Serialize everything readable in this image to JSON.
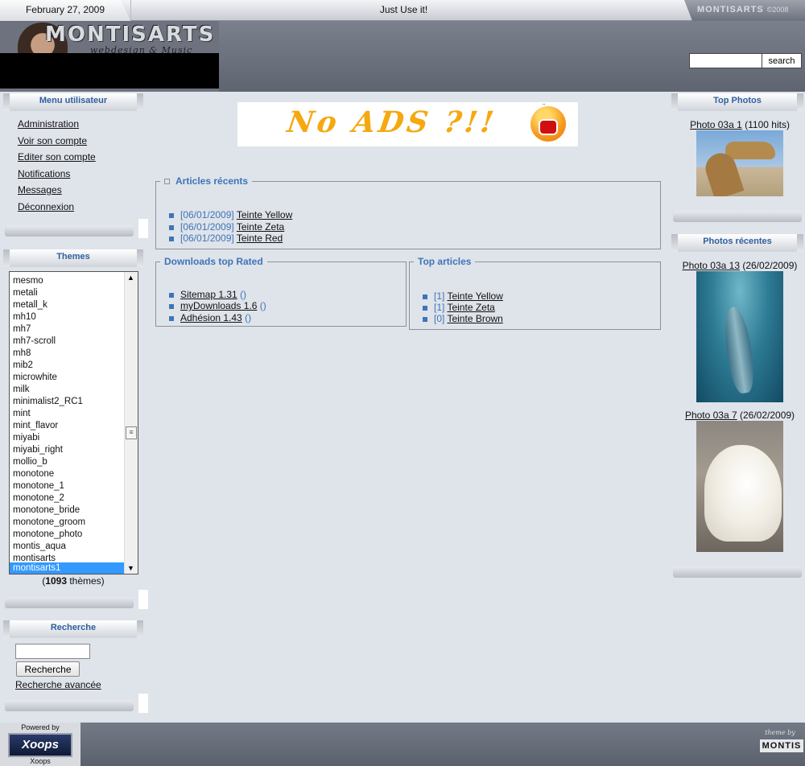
{
  "topbar": {
    "date": "February 27, 2009",
    "slogan": "Just Use it!",
    "brand": "MONTISARTS",
    "brand_year": "©2008"
  },
  "header": {
    "logo_text": "MONTISARTS",
    "logo_sub": "webdesign & Music",
    "search_button": "search",
    "search_value": ""
  },
  "left": {
    "user_menu_title": "Menu utilisateur",
    "user_menu": [
      "Administration",
      "Voir son compte",
      "Editer son compte",
      "Notifications",
      "Messages",
      "Déconnexion"
    ],
    "themes_title": "Themes",
    "themes": [
      "mesmo",
      "metali",
      "metall_k",
      "mh10",
      "mh7",
      "mh7-scroll",
      "mh8",
      "mib2",
      "microwhite",
      "milk",
      "minimalist2_RC1",
      "mint",
      "mint_flavor",
      "miyabi",
      "miyabi_right",
      "mollio_b",
      "monotone",
      "monotone_1",
      "monotone_2",
      "monotone_bride",
      "monotone_groom",
      "monotone_photo",
      "montis_aqua",
      "montisarts",
      "montisarts1"
    ],
    "themes_selected": "montisarts1",
    "themes_count_open": "(",
    "themes_count_num": "1093",
    "themes_count_label": " thèmes)",
    "search_title": "Recherche",
    "search_button": "Recherche",
    "advanced_search": "Recherche avancée"
  },
  "center": {
    "ad_text": "No ADS ?!!",
    "recent_articles": {
      "legend": "Articles récents",
      "items": [
        {
          "date": "[06/01/2009]",
          "title": "Teinte Yellow"
        },
        {
          "date": "[06/01/2009]",
          "title": "Teinte Zeta"
        },
        {
          "date": "[06/01/2009]",
          "title": "Teinte Red"
        }
      ]
    },
    "downloads": {
      "legend": "Downloads top Rated",
      "items": [
        {
          "title": "Sitemap 1.31",
          "paren": "()"
        },
        {
          "title": "myDownloads 1.6",
          "paren": "()"
        },
        {
          "title": "Adhésion 1.43",
          "paren": "()"
        }
      ]
    },
    "top_articles": {
      "legend": "Top articles",
      "items": [
        {
          "count": "[1]",
          "title": "Teinte Yellow"
        },
        {
          "count": "[1]",
          "title": "Teinte Zeta"
        },
        {
          "count": "[0]",
          "title": "Teinte Brown"
        }
      ]
    }
  },
  "right": {
    "top_photos_title": "Top Photos",
    "top_photo": {
      "title": "Photo 03a 1",
      "meta": " (1100 hits)"
    },
    "recent_photos_title": "Photos récentes",
    "recent_photos": [
      {
        "title": "Photo 03a 13",
        "meta": " (26/02/2009)"
      },
      {
        "title": "Photo 03a 7",
        "meta": " (26/02/2009)"
      }
    ]
  },
  "footer": {
    "powered_top": "Powered by",
    "powered_logo": "Xoops",
    "powered_bottom": "Xoops",
    "theme_by": "theme by",
    "theme_by_logo": "MONTIS"
  },
  "colors": {
    "accent": "#3d75b8",
    "selection": "#3399ff",
    "background": "#dfe3ea"
  }
}
